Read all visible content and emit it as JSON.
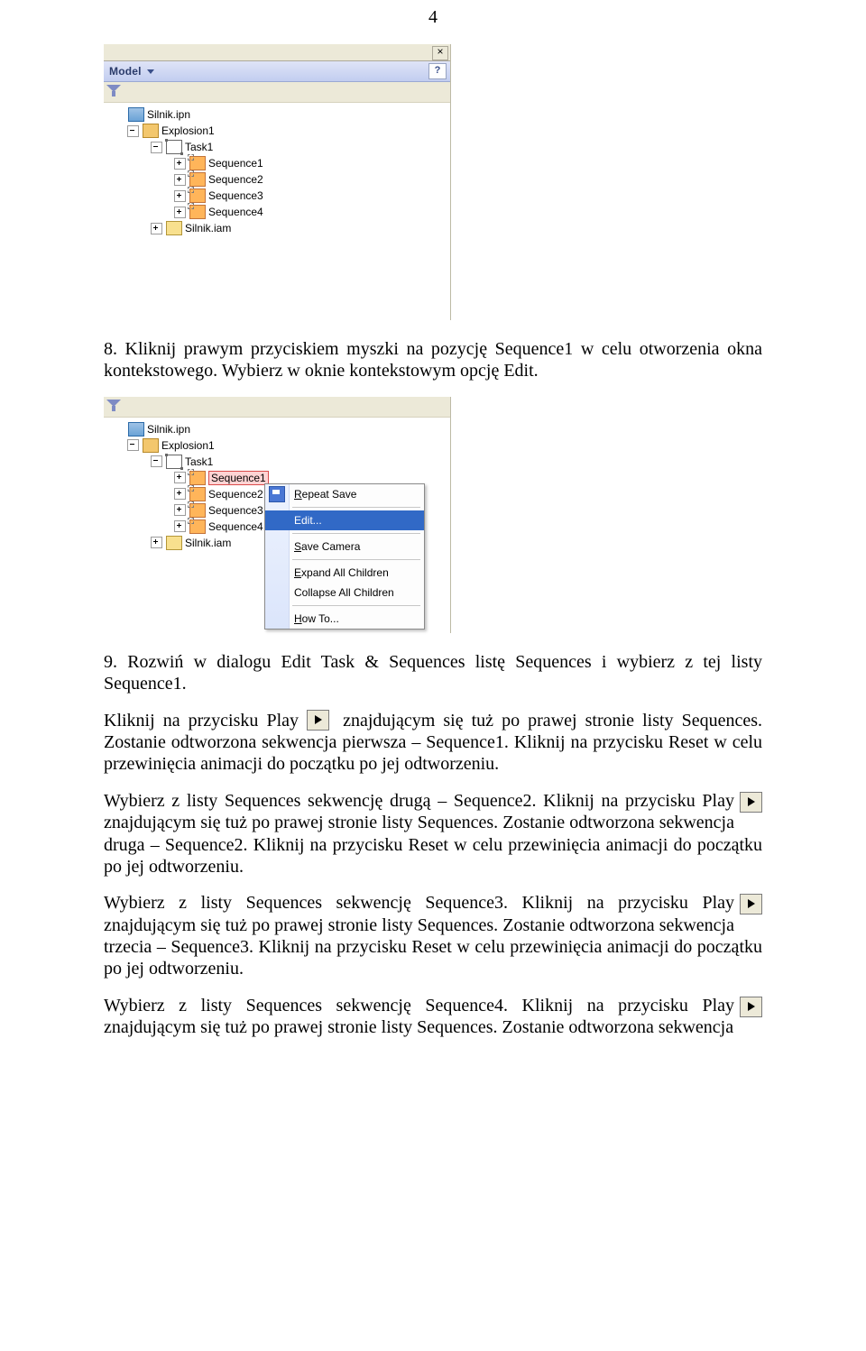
{
  "page_number": "4",
  "panel1": {
    "model_label": "Model",
    "tree": {
      "root": "Silnik.ipn",
      "explosion": "Explosion1",
      "task": "Task1",
      "seq1": "Sequence1",
      "seq2": "Sequence2",
      "seq3": "Sequence3",
      "seq4": "Sequence4",
      "iam": "Silnik.iam"
    }
  },
  "step8": "8. Kliknij prawym przyciskiem myszki na pozycję Sequence1 w celu otworzenia okna kontekstowego. Wybierz w oknie kontekstowym opcję Edit.",
  "panel2": {
    "tree": {
      "root": "Silnik.ipn",
      "explosion": "Explosion1",
      "task": "Task1",
      "seq1": "Sequence1",
      "seq2": "Sequence2",
      "seq3": "Sequence3",
      "seq4": "Sequence4",
      "iam": "Silnik.iam"
    },
    "ctx": {
      "repeat_R": "R",
      "repeat_rest": "epeat Save",
      "edit": "Edit...",
      "save_S": "S",
      "save_rest": "ave Camera",
      "expand_E": "E",
      "expand_rest": "xpand All Children",
      "collapse": "Collapse All Children",
      "howto_H": "H",
      "howto_rest": "ow To..."
    }
  },
  "step9_para1_a": "9. Rozwiń w dialogu Edit Task & Sequences listę Sequences i wybierz z tej listy Sequence1.",
  "step9_para1_b_pre": "Kliknij na przycisku Play ",
  "step9_para1_b_post": " znajdującym się tuż po prawej stronie listy Sequences. Zostanie odtworzona sekwencja pierwsza – Sequence1. Kliknij na przycisku Reset w celu przewinięcia animacji do początku po jej odtworzeniu.",
  "step9_para2_pre": "Wybierz z listy Sequences sekwencję drugą – Sequence2. Kliknij na przycisku Play ",
  "step9_para2_post": "znajdującym się tuż po prawej stronie listy Sequences. Zostanie odtworzona sekwencja druga – Sequence2. Kliknij na przycisku Reset w celu przewinięcia animacji do początku po jej odtworzeniu.",
  "step9_para3_pre": "Wybierz z listy Sequences sekwencję Sequence3. Kliknij na przycisku Play ",
  "step9_para3_post": "znajdującym się tuż po prawej stronie listy Sequences. Zostanie odtworzona sekwencja trzecia – Sequence3. Kliknij na przycisku Reset w celu przewinięcia animacji do początku po jej odtworzeniu.",
  "step9_para4_pre": "Wybierz z listy Sequences sekwencję Sequence4. Kliknij na przycisku Play ",
  "step9_para4_post": "znajdującym się tuż po prawej stronie listy Sequences. Zostanie odtworzona sekwencja"
}
